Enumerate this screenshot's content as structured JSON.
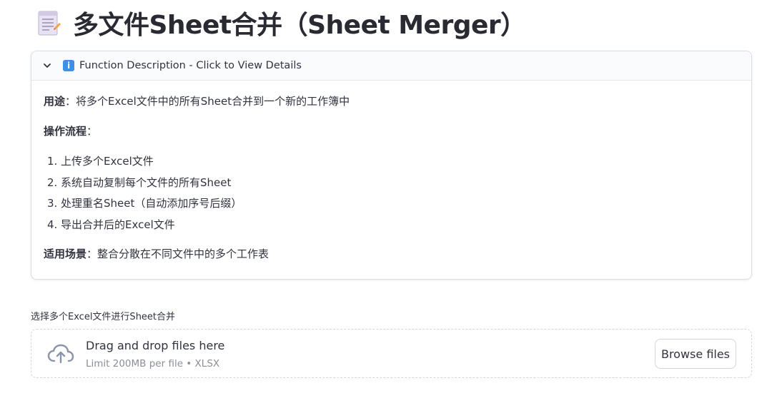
{
  "page_title": "多文件Sheet合并（Sheet Merger）",
  "title_icon": "memo-icon",
  "expander": {
    "icon": "info-icon",
    "info_glyph": "i",
    "label": "Function Description - Click to View Details",
    "purpose_label": "用途",
    "purpose_text": "：将多个Excel文件中的所有Sheet合并到一个新的工作簿中",
    "process_label": "操作流程",
    "process_colon": "：",
    "steps": [
      {
        "num": "1.",
        "text": "上传多个Excel文件"
      },
      {
        "num": "2.",
        "text": "系统自动复制每个文件的所有Sheet"
      },
      {
        "num": "3.",
        "text": "处理重名Sheet（自动添加序号后缀）"
      },
      {
        "num": "4.",
        "text": "导出合并后的Excel文件"
      }
    ],
    "scenario_label": "适用场景",
    "scenario_text": "：整合分散在不同文件中的多个工作表"
  },
  "uploader": {
    "label": "选择多个Excel文件进行Sheet合并",
    "drag_text": "Drag and drop files here",
    "limit_text": "Limit 200MB per file • XLSX",
    "browse_label": "Browse files",
    "icon": "cloud-upload-icon"
  }
}
